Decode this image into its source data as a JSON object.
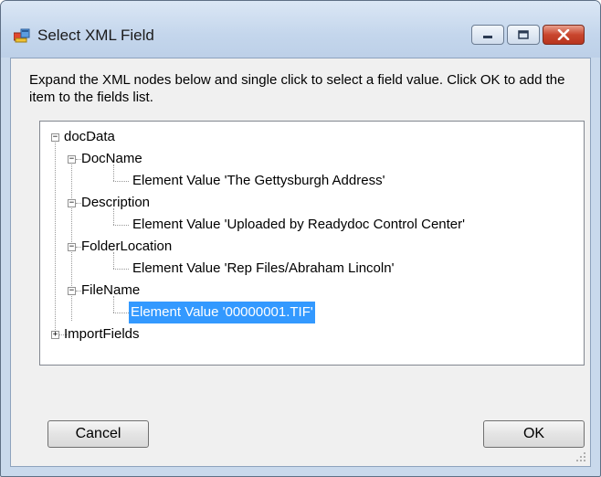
{
  "window": {
    "title": "Select XML Field"
  },
  "instruction": "Expand the XML nodes below and single click to select a field value.  Click OK to add the item to the fields list.",
  "tree": {
    "root": "docData",
    "doc_name": "DocName",
    "doc_name_value": "Element Value 'The Gettysburgh Address'",
    "description": "Description",
    "description_value": "Element Value 'Uploaded by Readydoc Control Center'",
    "folder_location": "FolderLocation",
    "folder_location_value": "Element Value 'Rep Files/Abraham Lincoln'",
    "file_name": "FileName",
    "file_name_value": "Element Value '00000001.TIF'",
    "import_fields": "ImportFields",
    "expanded_glyph": "−",
    "collapsed_glyph": "+"
  },
  "buttons": {
    "cancel": "Cancel",
    "ok": "OK"
  },
  "colors": {
    "selection": "#3399ff",
    "close_button": "#c9462e"
  }
}
